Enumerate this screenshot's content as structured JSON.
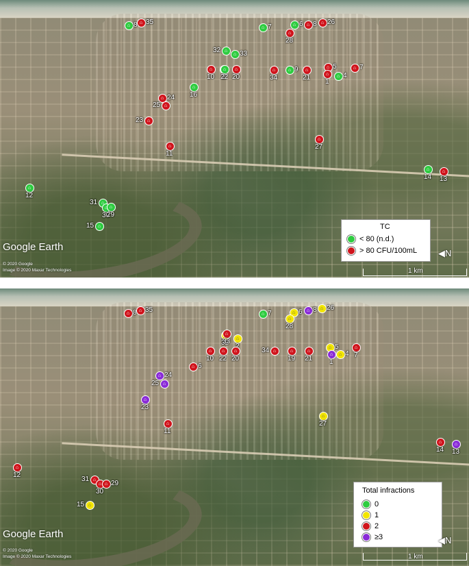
{
  "colors": {
    "green": "#2ecc40",
    "red": "#d0141c",
    "yellow": "#f2e500",
    "purple": "#8a2bd8"
  },
  "icon": "house-icon",
  "top_panel": {
    "logo": "Google Earth",
    "credit_line1": "© 2020 Google",
    "credit_line2": "Image © 2020 Maxar Technologies",
    "north_label": "N",
    "scale_label": "1 km",
    "legend": {
      "title": "TC",
      "items": [
        {
          "label": "< 80 (n.d.)",
          "color": "green"
        },
        {
          "label": "> 80 CFU/100mL",
          "color": "red"
        }
      ]
    },
    "sites": [
      {
        "id": "8",
        "c": "green"
      },
      {
        "id": "35",
        "c": "red"
      },
      {
        "id": "7",
        "c": "green"
      },
      {
        "id": "6",
        "c": "green"
      },
      {
        "id": "8",
        "c": "red"
      },
      {
        "id": "26",
        "c": "red"
      },
      {
        "id": "28",
        "c": "red"
      },
      {
        "id": "32",
        "c": "green"
      },
      {
        "id": "33",
        "c": "green"
      },
      {
        "id": "2",
        "c": "green"
      },
      {
        "id": "10",
        "c": "red"
      },
      {
        "id": "22",
        "c": "green"
      },
      {
        "id": "20",
        "c": "red"
      },
      {
        "id": "34",
        "c": "red"
      },
      {
        "id": "9",
        "c": "green"
      },
      {
        "id": "21",
        "c": "red"
      },
      {
        "id": "5",
        "c": "red"
      },
      {
        "id": "1",
        "c": "red"
      },
      {
        "id": "4",
        "c": "green"
      },
      {
        "id": "7",
        "c": "red"
      },
      {
        "id": "16",
        "c": "green"
      },
      {
        "id": "24",
        "c": "red"
      },
      {
        "id": "25",
        "c": "red"
      },
      {
        "id": "23",
        "c": "red"
      },
      {
        "id": "27",
        "c": "red"
      },
      {
        "id": "11",
        "c": "red"
      },
      {
        "id": "14",
        "c": "green"
      },
      {
        "id": "13",
        "c": "red"
      },
      {
        "id": "12",
        "c": "green"
      },
      {
        "id": "31",
        "c": "green"
      },
      {
        "id": "30",
        "c": "green"
      },
      {
        "id": "29",
        "c": "green"
      },
      {
        "id": "15",
        "c": "green"
      }
    ]
  },
  "bottom_panel": {
    "logo": "Google Earth",
    "credit_line1": "© 2020 Google",
    "credit_line2": "Image © 2020 Maxar Technologies",
    "north_label": "N",
    "scale_label": "1 km",
    "legend": {
      "title": "Total  infractions",
      "items": [
        {
          "label": "0",
          "color": "green"
        },
        {
          "label": "1",
          "color": "yellow"
        },
        {
          "label": "2",
          "color": "red"
        },
        {
          "label": "≥3",
          "color": "purple"
        }
      ]
    },
    "sites": [
      {
        "id": "8",
        "c": "red"
      },
      {
        "id": "35",
        "c": "red"
      },
      {
        "id": "7",
        "c": "green"
      },
      {
        "id": "6",
        "c": "yellow"
      },
      {
        "id": "8",
        "c": "purple"
      },
      {
        "id": "26",
        "c": "yellow"
      },
      {
        "id": "28",
        "c": "yellow"
      },
      {
        "id": "32",
        "c": "yellow"
      },
      {
        "id": "33",
        "c": "red"
      },
      {
        "id": "2",
        "c": "yellow"
      },
      {
        "id": "10",
        "c": "red"
      },
      {
        "id": "22",
        "c": "red"
      },
      {
        "id": "20",
        "c": "red"
      },
      {
        "id": "34",
        "c": "red"
      },
      {
        "id": "19",
        "c": "red"
      },
      {
        "id": "21",
        "c": "red"
      },
      {
        "id": "5",
        "c": "yellow"
      },
      {
        "id": "1",
        "c": "purple"
      },
      {
        "id": "4",
        "c": "yellow"
      },
      {
        "id": "7",
        "c": "red"
      },
      {
        "id": "6",
        "c": "red"
      },
      {
        "id": "24",
        "c": "purple"
      },
      {
        "id": "25",
        "c": "purple"
      },
      {
        "id": "23",
        "c": "purple"
      },
      {
        "id": "27",
        "c": "yellow"
      },
      {
        "id": "11",
        "c": "red"
      },
      {
        "id": "14",
        "c": "red"
      },
      {
        "id": "13",
        "c": "purple"
      },
      {
        "id": "12",
        "c": "red"
      },
      {
        "id": "31",
        "c": "red"
      },
      {
        "id": "30",
        "c": "red"
      },
      {
        "id": "29",
        "c": "red"
      },
      {
        "id": "15",
        "c": "yellow"
      }
    ]
  }
}
